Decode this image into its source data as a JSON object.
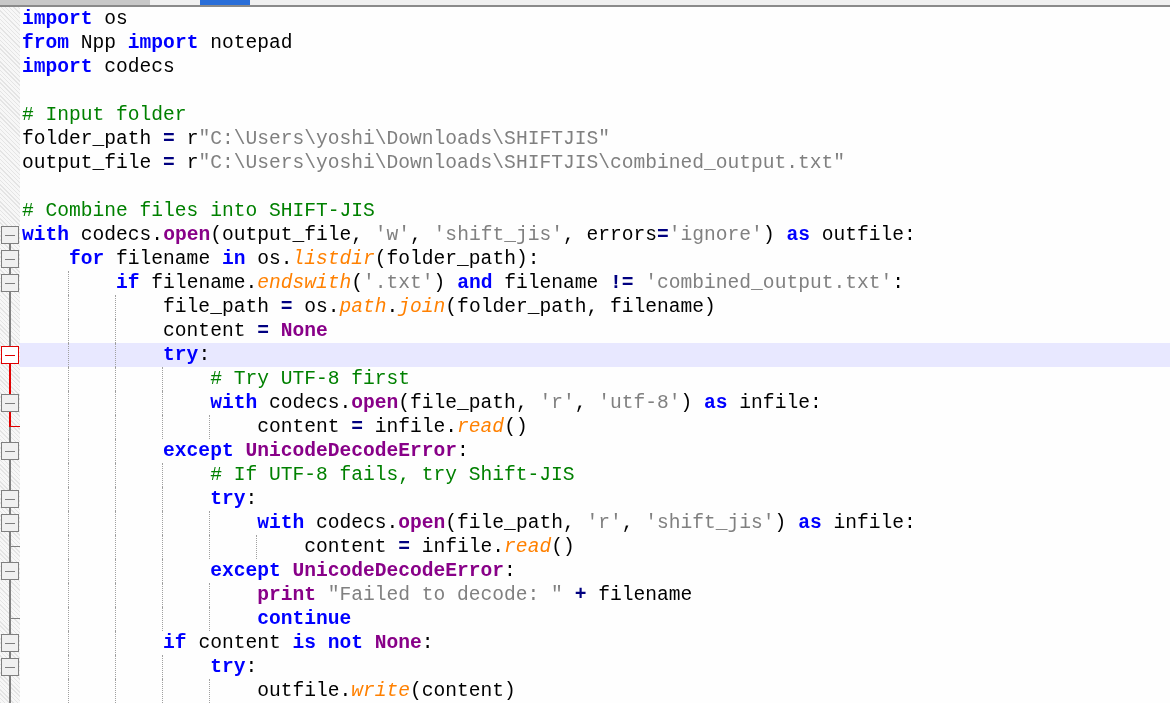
{
  "lines": [
    {
      "current": false,
      "tokens": [
        {
          "kind": "kw",
          "text": "import"
        },
        {
          "kind": "plain",
          "text": " os"
        }
      ]
    },
    {
      "current": false,
      "tokens": [
        {
          "kind": "kw",
          "text": "from"
        },
        {
          "kind": "plain",
          "text": " Npp "
        },
        {
          "kind": "kw",
          "text": "import"
        },
        {
          "kind": "plain",
          "text": " notepad"
        }
      ]
    },
    {
      "current": false,
      "tokens": [
        {
          "kind": "kw",
          "text": "import"
        },
        {
          "kind": "plain",
          "text": " codecs"
        }
      ]
    },
    {
      "current": false
    },
    {
      "current": false,
      "tokens": [
        {
          "kind": "comment",
          "text": "# Input folder"
        }
      ]
    },
    {
      "current": false,
      "tokens": [
        {
          "kind": "plain",
          "text": "folder_path "
        },
        {
          "kind": "op",
          "text": "="
        },
        {
          "kind": "plain",
          "text": " r"
        },
        {
          "kind": "string",
          "text": "\"C:\\Users\\yoshi\\Downloads\\SHIFTJIS\""
        }
      ]
    },
    {
      "current": false,
      "tokens": [
        {
          "kind": "plain",
          "text": "output_file "
        },
        {
          "kind": "op",
          "text": "="
        },
        {
          "kind": "plain",
          "text": " r"
        },
        {
          "kind": "string",
          "text": "\"C:\\Users\\yoshi\\Downloads\\SHIFTJIS\\combined_output.txt\""
        }
      ]
    },
    {
      "current": false
    },
    {
      "current": false,
      "tokens": [
        {
          "kind": "comment",
          "text": "# Combine files into SHIFT-JIS"
        }
      ]
    },
    {
      "current": false,
      "expanded": true,
      "fold_highlight": false,
      "tokens": [
        {
          "kind": "kw",
          "text": "with"
        },
        {
          "kind": "plain",
          "text": " codecs."
        },
        {
          "kind": "kw2",
          "text": "open"
        },
        {
          "kind": "plain",
          "text": "(output_file, "
        },
        {
          "kind": "string",
          "text": "'w'"
        },
        {
          "kind": "plain",
          "text": ", "
        },
        {
          "kind": "string",
          "text": "'shift_jis'"
        },
        {
          "kind": "plain",
          "text": ", errors"
        },
        {
          "kind": "op",
          "text": "="
        },
        {
          "kind": "string",
          "text": "'ignore'"
        },
        {
          "kind": "plain",
          "text": ") "
        },
        {
          "kind": "kw",
          "text": "as"
        },
        {
          "kind": "plain",
          "text": " outfile:"
        }
      ],
      "children": [
        {
          "current": false,
          "expanded": true,
          "fold_highlight": false,
          "tokens": [
            {
              "kind": "kw",
              "text": "for"
            },
            {
              "kind": "plain",
              "text": " filename "
            },
            {
              "kind": "kw",
              "text": "in"
            },
            {
              "kind": "plain",
              "text": " os."
            },
            {
              "kind": "method",
              "text": "listdir"
            },
            {
              "kind": "plain",
              "text": "(folder_path):"
            }
          ],
          "children": [
            {
              "current": false,
              "expanded": true,
              "fold_highlight": false,
              "tokens": [
                {
                  "kind": "kw",
                  "text": "if"
                },
                {
                  "kind": "plain",
                  "text": " filename."
                },
                {
                  "kind": "method",
                  "text": "endswith"
                },
                {
                  "kind": "plain",
                  "text": "("
                },
                {
                  "kind": "string",
                  "text": "'.txt'"
                },
                {
                  "kind": "plain",
                  "text": ") "
                },
                {
                  "kind": "kw",
                  "text": "and"
                },
                {
                  "kind": "plain",
                  "text": " filename "
                },
                {
                  "kind": "op",
                  "text": "!="
                },
                {
                  "kind": "string",
                  "text": " 'combined_output.txt'"
                },
                {
                  "kind": "plain",
                  "text": ":"
                }
              ],
              "children": [
                {
                  "current": false,
                  "tokens": [
                    {
                      "kind": "plain",
                      "text": "file_path "
                    },
                    {
                      "kind": "op",
                      "text": "="
                    },
                    {
                      "kind": "plain",
                      "text": " os."
                    },
                    {
                      "kind": "method",
                      "text": "path"
                    },
                    {
                      "kind": "plain",
                      "text": "."
                    },
                    {
                      "kind": "method",
                      "text": "join"
                    },
                    {
                      "kind": "plain",
                      "text": "(folder_path, filename)"
                    }
                  ]
                },
                {
                  "current": false,
                  "tokens": [
                    {
                      "kind": "plain",
                      "text": "content "
                    },
                    {
                      "kind": "op",
                      "text": "="
                    },
                    {
                      "kind": "kw2",
                      "text": " None"
                    }
                  ]
                },
                {
                  "current": true,
                  "expanded": true,
                  "fold_highlight": true,
                  "tokens": [
                    {
                      "kind": "kw",
                      "text": "try"
                    },
                    {
                      "kind": "plain",
                      "text": ":"
                    }
                  ],
                  "children": [
                    {
                      "current": false,
                      "tokens": [
                        {
                          "kind": "comment",
                          "text": "# Try UTF-8 first"
                        }
                      ]
                    },
                    {
                      "current": false,
                      "expanded": true,
                      "fold_highlight": false,
                      "tokens": [
                        {
                          "kind": "kw",
                          "text": "with"
                        },
                        {
                          "kind": "plain",
                          "text": " codecs."
                        },
                        {
                          "kind": "kw2",
                          "text": "open"
                        },
                        {
                          "kind": "plain",
                          "text": "(file_path, "
                        },
                        {
                          "kind": "string",
                          "text": "'r'"
                        },
                        {
                          "kind": "plain",
                          "text": ", "
                        },
                        {
                          "kind": "string",
                          "text": "'utf-8'"
                        },
                        {
                          "kind": "plain",
                          "text": ") "
                        },
                        {
                          "kind": "kw",
                          "text": "as"
                        },
                        {
                          "kind": "plain",
                          "text": " infile:"
                        }
                      ],
                      "children": [
                        {
                          "current": false,
                          "tokens": [
                            {
                              "kind": "plain",
                              "text": "content "
                            },
                            {
                              "kind": "op",
                              "text": "="
                            },
                            {
                              "kind": "plain",
                              "text": " infile."
                            },
                            {
                              "kind": "method",
                              "text": "read"
                            },
                            {
                              "kind": "plain",
                              "text": "()"
                            }
                          ]
                        }
                      ]
                    }
                  ]
                },
                {
                  "current": false,
                  "expanded": true,
                  "fold_highlight": false,
                  "tokens": [
                    {
                      "kind": "kw",
                      "text": "except"
                    },
                    {
                      "kind": "kw2",
                      "text": " UnicodeDecodeError"
                    },
                    {
                      "kind": "plain",
                      "text": ":"
                    }
                  ],
                  "children": [
                    {
                      "current": false,
                      "tokens": [
                        {
                          "kind": "comment",
                          "text": "# If UTF-8 fails, try Shift-JIS"
                        }
                      ]
                    },
                    {
                      "current": false,
                      "expanded": true,
                      "fold_highlight": false,
                      "tokens": [
                        {
                          "kind": "kw",
                          "text": "try"
                        },
                        {
                          "kind": "plain",
                          "text": ":"
                        }
                      ],
                      "children": [
                        {
                          "current": false,
                          "expanded": true,
                          "fold_highlight": false,
                          "tokens": [
                            {
                              "kind": "kw",
                              "text": "with"
                            },
                            {
                              "kind": "plain",
                              "text": " codecs."
                            },
                            {
                              "kind": "kw2",
                              "text": "open"
                            },
                            {
                              "kind": "plain",
                              "text": "(file_path, "
                            },
                            {
                              "kind": "string",
                              "text": "'r'"
                            },
                            {
                              "kind": "plain",
                              "text": ", "
                            },
                            {
                              "kind": "string",
                              "text": "'shift_jis'"
                            },
                            {
                              "kind": "plain",
                              "text": ") "
                            },
                            {
                              "kind": "kw",
                              "text": "as"
                            },
                            {
                              "kind": "plain",
                              "text": " infile:"
                            }
                          ],
                          "children": [
                            {
                              "current": false,
                              "tokens": [
                                {
                                  "kind": "plain",
                                  "text": "content "
                                },
                                {
                                  "kind": "op",
                                  "text": "="
                                },
                                {
                                  "kind": "plain",
                                  "text": " infile."
                                },
                                {
                                  "kind": "method",
                                  "text": "read"
                                },
                                {
                                  "kind": "plain",
                                  "text": "()"
                                }
                              ]
                            }
                          ]
                        }
                      ]
                    },
                    {
                      "current": false,
                      "expanded": true,
                      "fold_highlight": false,
                      "tokens": [
                        {
                          "kind": "kw",
                          "text": "except"
                        },
                        {
                          "kind": "kw2",
                          "text": " UnicodeDecodeError"
                        },
                        {
                          "kind": "plain",
                          "text": ":"
                        }
                      ],
                      "children": [
                        {
                          "current": false,
                          "tokens": [
                            {
                              "kind": "kw2",
                              "text": "print"
                            },
                            {
                              "kind": "string",
                              "text": " \"Failed to decode: \""
                            },
                            {
                              "kind": "op",
                              "text": " +"
                            },
                            {
                              "kind": "plain",
                              "text": " filename"
                            }
                          ]
                        },
                        {
                          "current": false,
                          "tokens": [
                            {
                              "kind": "kw",
                              "text": "continue"
                            }
                          ]
                        }
                      ]
                    }
                  ]
                },
                {
                  "current": false,
                  "expanded": true,
                  "fold_highlight": false,
                  "tokens": [
                    {
                      "kind": "kw",
                      "text": "if"
                    },
                    {
                      "kind": "plain",
                      "text": " content "
                    },
                    {
                      "kind": "kw",
                      "text": "is"
                    },
                    {
                      "kind": "kw",
                      "text": " not"
                    },
                    {
                      "kind": "kw2",
                      "text": " None"
                    },
                    {
                      "kind": "plain",
                      "text": ":"
                    }
                  ],
                  "children": [
                    {
                      "current": false,
                      "expanded": true,
                      "fold_highlight": false,
                      "tokens": [
                        {
                          "kind": "kw",
                          "text": "try"
                        },
                        {
                          "kind": "plain",
                          "text": ":"
                        }
                      ],
                      "children": [
                        {
                          "current": false,
                          "tokens": [
                            {
                              "kind": "plain",
                              "text": "outfile."
                            },
                            {
                              "kind": "method",
                              "text": "write"
                            },
                            {
                              "kind": "plain",
                              "text": "(content)"
                            }
                          ]
                        }
                      ]
                    }
                  ]
                }
              ]
            }
          ]
        }
      ]
    }
  ]
}
